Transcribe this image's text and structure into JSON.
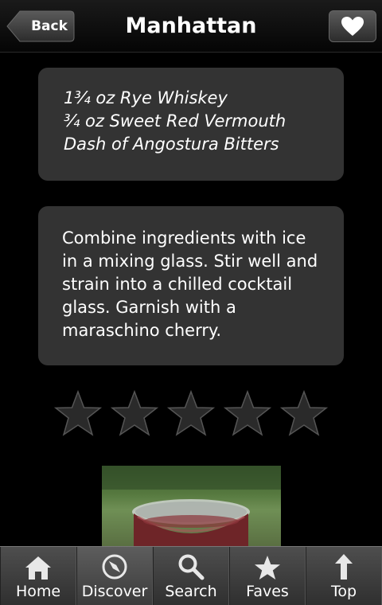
{
  "header": {
    "back_label": "Back",
    "title": "Manhattan",
    "favorite_icon": "heart-icon"
  },
  "ingredients": [
    "1¾ oz Rye Whiskey",
    "¾ oz Sweet Red Vermouth",
    "Dash of Angostura Bitters"
  ],
  "directions": "Combine ingredients with ice in a mixing glass. Stir well and strain into a chilled cocktail glass. Garnish with a maraschino cherry.",
  "rating": {
    "value": 0,
    "max": 5
  },
  "tabs": [
    {
      "label": "Home",
      "icon": "home-icon"
    },
    {
      "label": "Discover",
      "icon": "compass-icon"
    },
    {
      "label": "Search",
      "icon": "search-icon"
    },
    {
      "label": "Faves",
      "icon": "star-icon"
    },
    {
      "label": "Top",
      "icon": "arrow-up-icon"
    }
  ],
  "colors": {
    "background": "#000000",
    "card": "#333333",
    "tabbar": "#3c3c3c"
  }
}
